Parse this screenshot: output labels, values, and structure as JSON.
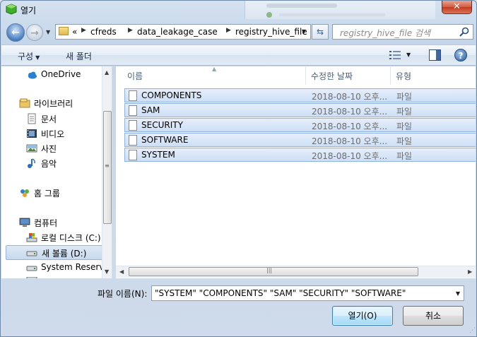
{
  "window": {
    "title": "열기",
    "close_label": "✕"
  },
  "address": {
    "prefix": "«",
    "crumbs": [
      "cfreds",
      "data_leakage_case",
      "registry_hive_file"
    ]
  },
  "search": {
    "placeholder": "registry_hive_file 검색"
  },
  "toolbar": {
    "organize_label": "구성",
    "new_folder_label": "새 폴더",
    "help_label": "?"
  },
  "nav": {
    "items": [
      {
        "label": "OneDrive",
        "icon": "cloud-icon"
      },
      {
        "label": "라이브러리",
        "icon": "library-icon"
      },
      {
        "label": "문서",
        "icon": "document-icon"
      },
      {
        "label": "비디오",
        "icon": "video-icon"
      },
      {
        "label": "사진",
        "icon": "picture-icon"
      },
      {
        "label": "음악",
        "icon": "music-icon"
      },
      {
        "label": "홈 그룹",
        "icon": "homegroup-icon"
      },
      {
        "label": "컴퓨터",
        "icon": "computer-icon"
      },
      {
        "label": "로컬 디스크 (C:)",
        "icon": "disk-icon"
      },
      {
        "label": "새 볼륨 (D:)",
        "icon": "drive-icon",
        "selected": true
      },
      {
        "label": "System Reserved",
        "icon": "drive-icon"
      }
    ]
  },
  "files": {
    "columns": [
      "이름",
      "수정한 날짜",
      "유형"
    ],
    "rows": [
      {
        "name": "COMPONENTS",
        "date": "2018-08-10 오후...",
        "type": "파일"
      },
      {
        "name": "SAM",
        "date": "2018-08-10 오후...",
        "type": "파일"
      },
      {
        "name": "SECURITY",
        "date": "2018-08-10 오후...",
        "type": "파일"
      },
      {
        "name": "SOFTWARE",
        "date": "2018-08-10 오후...",
        "type": "파일"
      },
      {
        "name": "SYSTEM",
        "date": "2018-08-10 오후...",
        "type": "파일"
      }
    ]
  },
  "filename": {
    "label": "파일 이름(N):",
    "value": "\"SYSTEM\" \"COMPONENTS\" \"SAM\" \"SECURITY\" \"SOFTWARE\""
  },
  "buttons": {
    "open_label": "열기(O)",
    "cancel_label": "취소"
  },
  "colors": {
    "selection": "#cddff6",
    "accent": "#3c7fb1",
    "close": "#c23c1e"
  }
}
